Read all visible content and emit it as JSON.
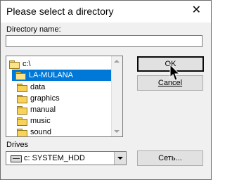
{
  "window": {
    "title": "Please select a directory",
    "close_glyph": "✕"
  },
  "directory": {
    "label": "Directory name:",
    "value": ""
  },
  "tree": {
    "items": [
      {
        "label": "c:\\",
        "type": "open-folder"
      },
      {
        "label": "LA-MULANA",
        "type": "open-folder",
        "selected": true
      },
      {
        "label": "data",
        "type": "folder"
      },
      {
        "label": "graphics",
        "type": "folder"
      },
      {
        "label": "manual",
        "type": "folder"
      },
      {
        "label": "music",
        "type": "folder"
      },
      {
        "label": "sound",
        "type": "folder"
      }
    ]
  },
  "buttons": {
    "ok": "OK",
    "cancel": "Cancel",
    "network": "Сеть..."
  },
  "drives": {
    "label": "Drives",
    "value": "c: SYSTEM_HDD"
  },
  "colors": {
    "selection": "#0078d7",
    "folder": "#f7d35a"
  }
}
